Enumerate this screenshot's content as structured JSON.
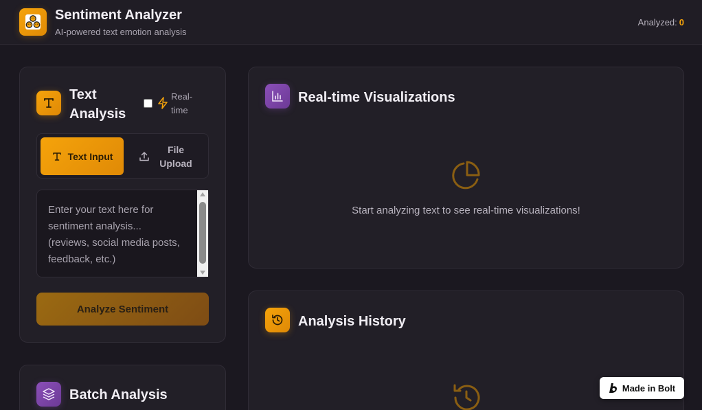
{
  "header": {
    "title": "Sentiment Analyzer",
    "subtitle": "AI-powered text emotion analysis",
    "analyzed_label": "Analyzed:",
    "analyzed_count": "0",
    "logo_icon": "emoji-faces-icon"
  },
  "text_analysis": {
    "title_line1": "Text",
    "title_line2": "Analysis",
    "icon": "text-type-icon",
    "realtime_label": "Real-time",
    "realtime_checked": false,
    "tabs": [
      {
        "label": "Text Input",
        "icon": "text-type-icon",
        "active": true
      },
      {
        "label": "File Upload",
        "icon": "upload-icon",
        "active": false
      }
    ],
    "textarea_placeholder": "Enter your text here for sentiment analysis...\n(reviews, social media posts, feedback, etc.)",
    "analyze_button": "Analyze Sentiment"
  },
  "batch": {
    "title": "Batch Analysis",
    "icon": "layers-icon"
  },
  "visualizations": {
    "title": "Real-time Visualizations",
    "icon": "bar-chart-icon",
    "empty_icon": "pie-chart-icon",
    "empty_message": "Start analyzing text to see real-time visualizations!"
  },
  "history": {
    "title": "Analysis History",
    "icon": "history-icon",
    "empty_icon": "history-icon"
  },
  "badge": {
    "label": "Made in Bolt"
  },
  "colors": {
    "accent": "#f5a30b",
    "purple": "#8b4fb8",
    "background": "#1b1820",
    "card": "#221f27"
  }
}
